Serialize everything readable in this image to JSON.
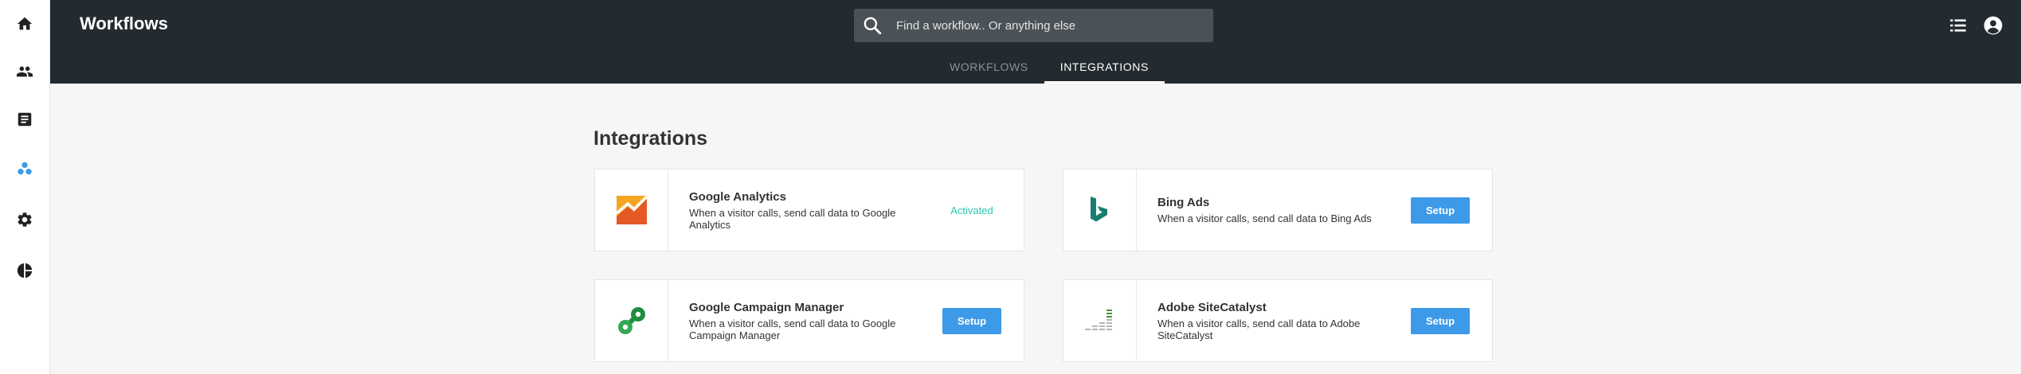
{
  "header": {
    "title": "Workflows",
    "search_placeholder": "Find a workflow.. Or anything else"
  },
  "rail": [
    {
      "icon": "home-icon"
    },
    {
      "icon": "people-icon"
    },
    {
      "icon": "document-icon"
    },
    {
      "icon": "workflows-icon",
      "active": true
    },
    {
      "icon": "gear-icon"
    },
    {
      "icon": "pie-chart-icon"
    }
  ],
  "tabs": [
    {
      "label": "Workflows",
      "active": false
    },
    {
      "label": "Integrations",
      "active": true
    }
  ],
  "section_title": "Integrations",
  "integrations": [
    {
      "name": "Google Analytics",
      "description": "When a visitor calls, send call data to Google Analytics",
      "status": "Activated"
    },
    {
      "name": "Bing Ads",
      "description": "When a visitor calls, send call data to Bing Ads",
      "action": "Setup"
    },
    {
      "name": "Google Campaign Manager",
      "description": "When a visitor calls, send call data to Google Campaign Manager",
      "action": "Setup"
    },
    {
      "name": "Adobe SiteCatalyst",
      "description": "When a visitor calls, send call data to Adobe SiteCatalyst",
      "action": "Setup"
    }
  ],
  "colors": {
    "header_bg": "#232b30",
    "accent": "#3d9ae8",
    "activated": "#2fc4b2"
  }
}
